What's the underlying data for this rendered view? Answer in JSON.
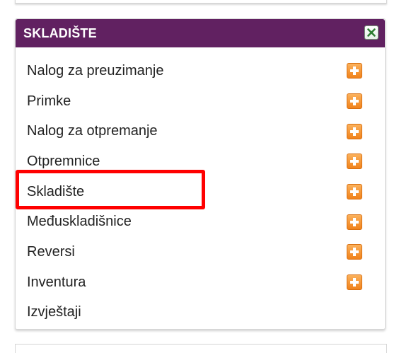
{
  "panel": {
    "title": "SKLADIŠTE",
    "header_color": "#612161",
    "close_icon": "close-x-icon"
  },
  "menu": {
    "items": [
      {
        "label": "Nalog za preuzimanje",
        "has_add": true
      },
      {
        "label": "Primke",
        "has_add": true
      },
      {
        "label": "Nalog za otpremanje",
        "has_add": true
      },
      {
        "label": "Otpremnice",
        "has_add": true
      },
      {
        "label": "Skladište",
        "has_add": true
      },
      {
        "label": "Međuskladišnice",
        "has_add": true
      },
      {
        "label": "Reversi",
        "has_add": true
      },
      {
        "label": "Inventura",
        "has_add": true
      },
      {
        "label": "Izvještaji",
        "has_add": false
      }
    ],
    "add_icon": "plus-icon",
    "add_color": "#f0821b"
  },
  "highlight": {
    "target": "Skladište",
    "color": "#ff0000"
  }
}
